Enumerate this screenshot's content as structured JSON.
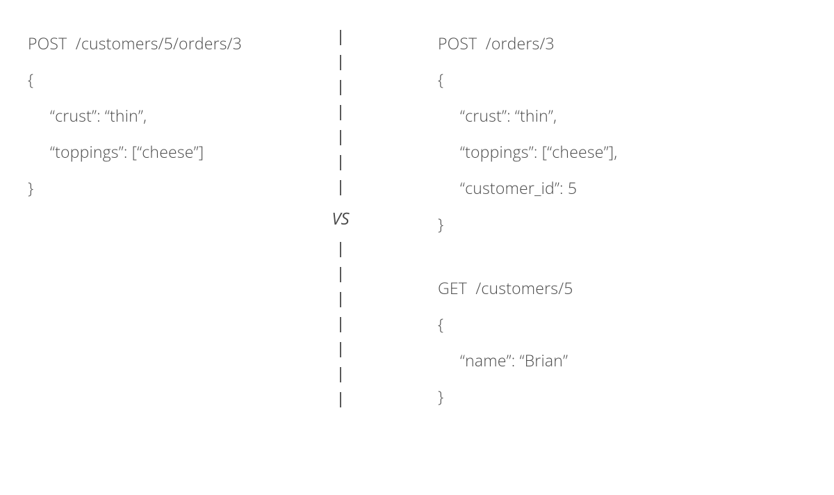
{
  "left": {
    "request1": {
      "line1": "POST  /customers/5/orders/3",
      "line2": "{",
      "line3": "“crust”: “thin”,",
      "line4": "“toppings”: [“cheese”]",
      "line5": "}"
    }
  },
  "divider": {
    "vs": "VS"
  },
  "right": {
    "request1": {
      "line1": "POST  /orders/3",
      "line2": "{",
      "line3": "“crust”: “thin”,",
      "line4": "“toppings”: [“cheese”],",
      "line5": "“customer_id”: 5",
      "line6": "}"
    },
    "request2": {
      "line1": "GET  /customers/5",
      "line2": "{",
      "line3": "“name”: “Brian”",
      "line4": "}"
    }
  }
}
